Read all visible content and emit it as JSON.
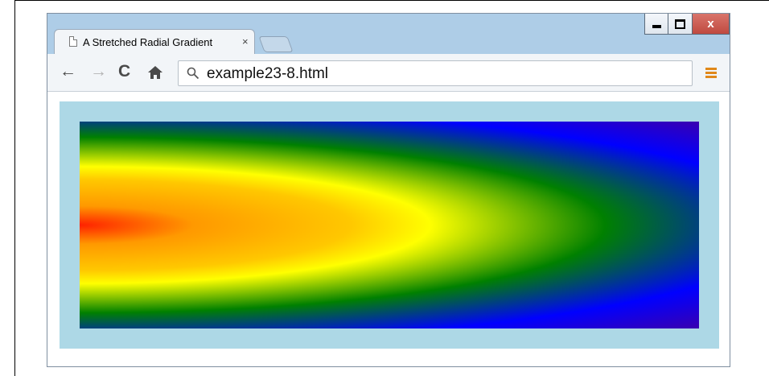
{
  "browser": {
    "tab": {
      "title": "A Stretched Radial Gradient",
      "close_glyph": "×",
      "favicon_icon": "page-icon"
    },
    "window_controls": {
      "minimize_icon": "minimize-icon",
      "maximize_icon": "maximize-icon",
      "close_glyph": "x"
    },
    "toolbar": {
      "back_glyph": "←",
      "forward_glyph": "→",
      "reload_glyph": "C",
      "home_icon": "home-icon",
      "menu_icon": "hamburger-menu-icon"
    },
    "omnibox": {
      "search_icon": "search-icon",
      "url": "example23-8.html"
    }
  },
  "page": {
    "container_color": "#add8e6",
    "gradient": {
      "type": "radial",
      "colors": [
        "#ff2200",
        "#ff9900",
        "#ffc800",
        "#ffff00",
        "#008000",
        "#0000ff",
        "#3a00b0"
      ]
    }
  },
  "colors": {
    "chrome_frame": "#aecde7",
    "close_button": "#c75047",
    "menu_accent": "#e0881a"
  }
}
